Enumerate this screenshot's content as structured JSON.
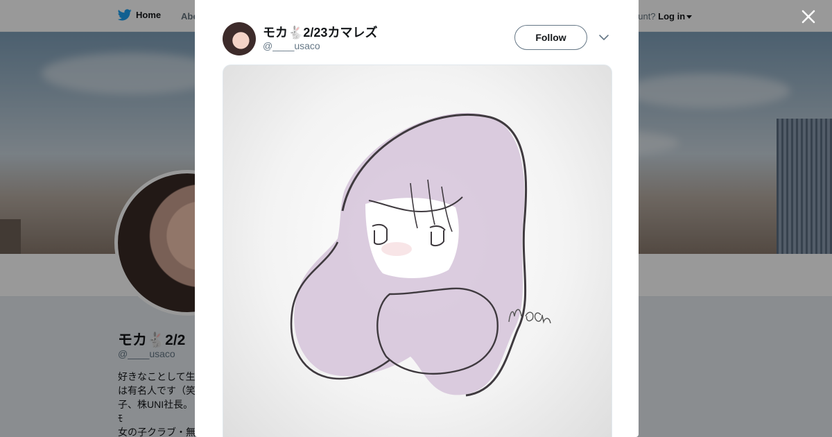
{
  "nav": {
    "home_label": "Home",
    "about_label": "Abo",
    "account_prompt": "ccount?",
    "login_label": "Log in"
  },
  "profile": {
    "name": "モカ🐇2/2",
    "handle": "@____usaco",
    "bio": "好きなことして生\nは有名人です（笑\n子、株UNI社長。ﾓ\n女の子クラブ・無\nす✨モカ🐇ファ"
  },
  "tweet": {
    "author_name": "モカ🐇2/23カマレズ",
    "author_handle": "@____usaco",
    "follow_label": "Follow",
    "image_signature": "Moka"
  },
  "colors": {
    "brand": "#1da1f2",
    "text": "#14171a",
    "muted": "#657786",
    "hair": "#d5c3d9"
  },
  "icons": {
    "twitter": "twitter-bird-icon",
    "close": "close-icon",
    "menu": "chevron-down-icon"
  }
}
